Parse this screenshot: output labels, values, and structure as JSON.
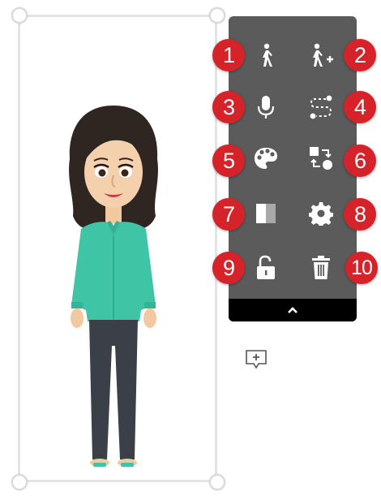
{
  "toolbar": {
    "badges": [
      "1",
      "2",
      "3",
      "4",
      "5",
      "6",
      "7",
      "8",
      "9",
      "10"
    ],
    "tools": [
      {
        "icon": "walk-icon"
      },
      {
        "icon": "add-walk-icon"
      },
      {
        "icon": "microphone-icon"
      },
      {
        "icon": "motion-path-icon"
      },
      {
        "icon": "palette-icon"
      },
      {
        "icon": "swap-icon"
      },
      {
        "icon": "opacity-icon"
      },
      {
        "icon": "gear-icon"
      },
      {
        "icon": "unlock-icon"
      },
      {
        "icon": "trash-icon"
      }
    ],
    "collapse_icon": "chevron-up-icon",
    "colors": {
      "panel": "#5b5b5b",
      "bar": "#000000",
      "badge": "#d6232a",
      "icon": "#ffffff"
    }
  },
  "canvas": {
    "character": "woman-character",
    "comment_icon": "add-comment-icon"
  }
}
